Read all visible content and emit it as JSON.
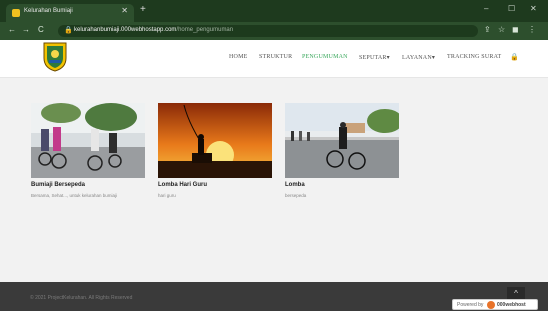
{
  "browser": {
    "tab_title": "Kelurahan Bumiaji",
    "tab_close": "✕",
    "new_tab": "+",
    "url_host": "kelurahanbumiaji.000webhostapp.com",
    "url_path": "/home_pengumuman",
    "win_min": "–",
    "win_max": "☐",
    "win_close": "✕",
    "back": "←",
    "forward": "→",
    "reload": "C",
    "lock": "🔒",
    "share_icon": "⇪",
    "star_icon": "☆",
    "ext_icon": "◼",
    "menu_icon": "⋮"
  },
  "site": {
    "nav": [
      {
        "label": "HOME",
        "active": false
      },
      {
        "label": "STRUKTUR",
        "active": false
      },
      {
        "label": "PENGUMUMAN",
        "active": true
      },
      {
        "label": "SEPUTAR▾",
        "active": false
      },
      {
        "label": "LAYANAN▾",
        "active": false
      },
      {
        "label": "TRACKING SURAT",
        "active": false
      }
    ],
    "search_icon": "🔒",
    "accent": "#3aa85c"
  },
  "cards": [
    {
      "title": "Bumiaji Bersepeda",
      "desc": "Bersama, Sehat..., untuk kelurahan bumiaji"
    },
    {
      "title": "Lomba Hari Guru",
      "desc": "hari guru"
    },
    {
      "title": "Lomba",
      "desc": "bersepeda"
    }
  ],
  "footer": {
    "copyright": "© 2021 ProjectKelurahan. All Rights Reserved",
    "scroll_top": "^",
    "powered_by": "Powered by",
    "host_name": "000webhost"
  }
}
